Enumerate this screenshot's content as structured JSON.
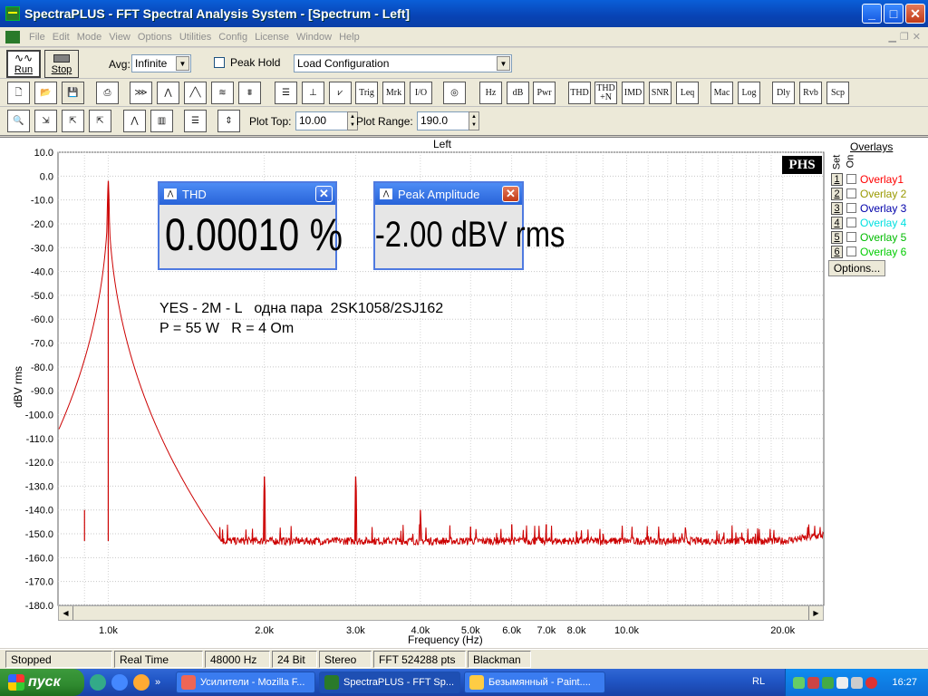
{
  "window": {
    "title": "SpectraPLUS - FFT Spectral Analysis System - [Spectrum - Left]",
    "min_label": "_",
    "max_label": "□",
    "close_label": "✕"
  },
  "menu": {
    "items": [
      "File",
      "Edit",
      "Mode",
      "View",
      "Options",
      "Utilities",
      "Config",
      "License",
      "Window",
      "Help"
    ]
  },
  "toolbar": {
    "run_label": "Run",
    "stop_label": "Stop",
    "avg_label": "Avg:",
    "avg_value": "Infinite",
    "peak_hold_label": "Peak Hold",
    "config_value": "Load Configuration",
    "plot_top_label": "Plot Top:",
    "plot_top_value": "10.00",
    "plot_range_label": "Plot Range:",
    "plot_range_value": "190.0",
    "buttons_row2": [
      "Trig",
      "Mrk",
      "I/O",
      "Hz",
      "dB",
      "Pwr",
      "THD",
      "THD +N",
      "IMD",
      "SNR",
      "Leq",
      "Mac",
      "Log",
      "Dly",
      "Rvb",
      "Scp"
    ]
  },
  "plot": {
    "title": "Left",
    "logo": "PHS",
    "annotation_line1": "YES - 2M - L   одна пара  2SK1058/2SJ162",
    "annotation_line2": "P = 55 W   R = 4 Om"
  },
  "meters": {
    "thd_title": "THD",
    "thd_value": "0.00010 %",
    "peak_title": "Peak Amplitude",
    "peak_value": "-2.00 dBV rms"
  },
  "overlays": {
    "title": "Overlays",
    "set_label": "Set",
    "on_label": "On",
    "options_label": "Options...",
    "items": [
      {
        "num": "1",
        "label": "Overlay1",
        "color": "#ff0000"
      },
      {
        "num": "2",
        "label": "Overlay 2",
        "color": "#999900"
      },
      {
        "num": "3",
        "label": "Overlay 3",
        "color": "#0000aa"
      },
      {
        "num": "4",
        "label": "Overlay 4",
        "color": "#00e0e0"
      },
      {
        "num": "5",
        "label": "Overlay 5",
        "color": "#00bb00"
      },
      {
        "num": "6",
        "label": "Overlay 6",
        "color": "#00cc00"
      }
    ]
  },
  "status": {
    "state": "Stopped",
    "mode": "Real Time",
    "rate": "48000 Hz",
    "bits": "24 Bit",
    "channels": "Stereo",
    "fft": "FFT 524288 pts",
    "window": "Blackman"
  },
  "taskbar": {
    "start_label": "пуск",
    "tasks": [
      "Усилители - Mozilla F...",
      "SpectraPLUS - FFT Sp...",
      "Безымянный - Paint...."
    ],
    "lang": "RL",
    "clock": "16:27"
  },
  "chart_data": {
    "type": "line",
    "title": "Left",
    "xlabel": "Frequency (Hz)",
    "ylabel": "dBV rms",
    "x_scale": "log",
    "xlim": [
      800,
      24000
    ],
    "ylim": [
      -180,
      10
    ],
    "y_ticks": [
      "10.0",
      "0.0",
      "-10.0",
      "-20.0",
      "-30.0",
      "-40.0",
      "-50.0",
      "-60.0",
      "-70.0",
      "-80.0",
      "-90.0",
      "-100.0",
      "-110.0",
      "-120.0",
      "-130.0",
      "-140.0",
      "-150.0",
      "-160.0",
      "-170.0",
      "-180.0"
    ],
    "x_ticks": [
      {
        "value": 1000,
        "label": "1.0k"
      },
      {
        "value": 2000,
        "label": "2.0k"
      },
      {
        "value": 3000,
        "label": "3.0k"
      },
      {
        "value": 4000,
        "label": "4.0k"
      },
      {
        "value": 5000,
        "label": "5.0k"
      },
      {
        "value": 6000,
        "label": "6.0k"
      },
      {
        "value": 7000,
        "label": "7.0k"
      },
      {
        "value": 8000,
        "label": "8.0k"
      },
      {
        "value": 10000,
        "label": "10.0k"
      },
      {
        "value": 20000,
        "label": "20.0k"
      }
    ],
    "series": [
      {
        "color": "#cc0000",
        "noise_floor": -153,
        "peaks": [
          {
            "x": 900,
            "y": -140
          },
          {
            "x": 1000,
            "y": -2
          },
          {
            "x": 2000,
            "y": -126
          },
          {
            "x": 3000,
            "y": -126
          },
          {
            "x": 4000,
            "y": -140
          },
          {
            "x": 5000,
            "y": -147
          },
          {
            "x": 6000,
            "y": -146
          },
          {
            "x": 7000,
            "y": -146
          },
          {
            "x": 8000,
            "y": -149
          },
          {
            "x": 9000,
            "y": -150
          },
          {
            "x": 11000,
            "y": -151
          }
        ]
      }
    ],
    "grid": true
  }
}
